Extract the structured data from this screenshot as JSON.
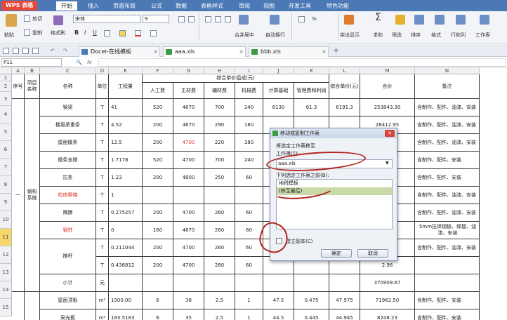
{
  "app": {
    "logo": "WPS 表格"
  },
  "menu": [
    "开始",
    "插入",
    "页面布局",
    "公式",
    "数据",
    "表格样式",
    "审阅",
    "视图",
    "开发工具",
    "特色功能"
  ],
  "ribbon": {
    "paste": "粘贴",
    "cut": "剪切",
    "copy": "复制",
    "format_painter": "格式刷",
    "font_name": "宋体",
    "font_size": "9",
    "merge_center": "合并居中",
    "wrap": "自动换行",
    "number_format": "%",
    "cond_format": "突出显示",
    "sum": "求和",
    "filter": "筛选",
    "sort": "排序",
    "format": "格式",
    "rowcol": "行和列",
    "sheet": "工作表"
  },
  "tabs": [
    {
      "label": "Docer-在线模板"
    },
    {
      "label": "aaa.xls"
    },
    {
      "label": "bbb.xls"
    }
  ],
  "formula_bar": {
    "name_box": "P11",
    "fx": "fx"
  },
  "columns": [
    "A",
    "B",
    "C",
    "D",
    "E",
    "F",
    "G",
    "H",
    "I",
    "J",
    "K",
    "L",
    "M",
    "N"
  ],
  "rows": [
    "1",
    "2",
    "3",
    "4",
    "5",
    "6",
    "7",
    "8",
    "9",
    "10",
    "11",
    "12",
    "13",
    "14",
    "15"
  ],
  "header": {
    "seq": "序号",
    "proj": "项目名称",
    "name": "名称",
    "unit": "单位",
    "qty": "工程量",
    "group": "综合单价组成(元)",
    "labor": "人工费",
    "material": "主材费",
    "aux": "辅材费",
    "machine": "机械费",
    "base": "计算基础",
    "mgmt": "管理费和利润",
    "unit_price": "综合单价(元)",
    "total": "合价",
    "note": "备注"
  },
  "merged": {
    "seq_val": "一",
    "proj_val": "钢构系统"
  },
  "body_rows": [
    {
      "name": "钢梁",
      "unit": "T",
      "qty": "41",
      "f": "520",
      "g": "4670",
      "h": "700",
      "i": "240",
      "j": "6130",
      "k": "61.3",
      "l": "6191.3",
      "m": "253843.30",
      "n": "含制作、配件、油漆、安装",
      "red": false
    },
    {
      "name": "楼层承重条",
      "unit": "T",
      "qty": "4.52",
      "f": "200",
      "g": "4670",
      "h": "290",
      "i": "180",
      "j": "",
      "k": "",
      "l": "",
      "m": "28412.95",
      "n": "含制作、配件、油漆、安装",
      "red": false
    },
    {
      "name": "屋面檩条",
      "unit": "T",
      "qty": "12.5",
      "f": "200",
      "g": "4700",
      "h": "220",
      "i": "180",
      "j": "",
      "k": "",
      "l": "",
      "m": "62.50",
      "n": "含制作、配件、油漆、安装",
      "red": false,
      "redg": true
    },
    {
      "name": "檩条支撑",
      "unit": "T",
      "qty": "1.7178",
      "f": "520",
      "g": "4700",
      "h": "700",
      "i": "240",
      "j": "",
      "k": "",
      "l": "",
      "m": "87.46",
      "n": "含制作、配件、安装",
      "red": false
    },
    {
      "name": "拉条",
      "unit": "T",
      "qty": "1.23",
      "f": "200",
      "g": "4800",
      "h": "250",
      "i": "60",
      "j": "",
      "k": "",
      "l": "",
      "m": "6.41",
      "n": "含制作、配件、安装",
      "red": false
    },
    {
      "name": "检修爬梯",
      "unit": "个",
      "qty": "1",
      "f": "",
      "g": "",
      "h": "",
      "i": "",
      "j": "",
      "k": "",
      "l": "",
      "m": "",
      "n": "含制作、配件、油漆、安装",
      "red": true
    },
    {
      "name": "隅撑",
      "unit": "T",
      "qty": "0.275257",
      "f": "200",
      "g": "4700",
      "h": "260",
      "i": "60",
      "j": "",
      "k": "",
      "l": "",
      "m": "1.21",
      "n": "含制作、配件、油漆、安装",
      "red": false
    },
    {
      "name": "钢柱",
      "unit": "T",
      "qty": "0",
      "f": "160",
      "g": "4670",
      "h": "260",
      "i": "60",
      "j": "",
      "k": "",
      "l": "",
      "m": ".00",
      "n": "5mm压焊钢板、焊接、油漆、安装",
      "red": true
    },
    {
      "name": "撑杆",
      "unit": "T",
      "qty": "0.211044",
      "f": "200",
      "g": "4700",
      "h": "260",
      "i": "60",
      "j": "",
      "k": "",
      "l": "",
      "m": "2.67",
      "n": "含制作、配件、油漆、安装",
      "red": false
    },
    {
      "name": "",
      "unit": "T",
      "qty": "0.436812",
      "f": "200",
      "g": "4700",
      "h": "260",
      "i": "60",
      "j": "",
      "k": "",
      "l": "",
      "m": "2.96",
      "n": "",
      "red": false
    },
    {
      "name": "小计",
      "unit": "元",
      "qty": "",
      "f": "",
      "g": "",
      "h": "",
      "i": "",
      "j": "",
      "k": "",
      "l": "",
      "m": "370909.67",
      "n": "",
      "red": false
    },
    {
      "name": "屋面顶板",
      "unit": "m²",
      "qty": "1500.00",
      "f": "6",
      "g": "38",
      "h": "2.5",
      "i": "1",
      "j": "47.5",
      "k": "0.475",
      "l": "47.975",
      "m": "71962.50",
      "n": "含制作、配件、安装",
      "red": false
    },
    {
      "name": "采光板",
      "unit": "m²",
      "qty": "183.5183",
      "f": "6",
      "g": "35",
      "h": "2.5",
      "i": "1",
      "j": "44.5",
      "k": "0.445",
      "l": "44.945",
      "m": "8248.23",
      "n": "含制作、配件、安装",
      "red": false
    }
  ],
  "dialog": {
    "title": "移动或复制工作表",
    "to_book_label": "将选定工作表移至",
    "book_label": "工作簿(T):",
    "book_value": "aaa.xls",
    "before_label": "下列选定工作表之前(B):",
    "items": [
      "地税模板",
      "(移至最后)"
    ],
    "copy_label": "建立副本(C)",
    "ok": "确定",
    "cancel": "取消"
  },
  "colors": {
    "menu_blue": "#4a79b6",
    "accent_red": "#e0312d",
    "mark": "#b3231c"
  }
}
